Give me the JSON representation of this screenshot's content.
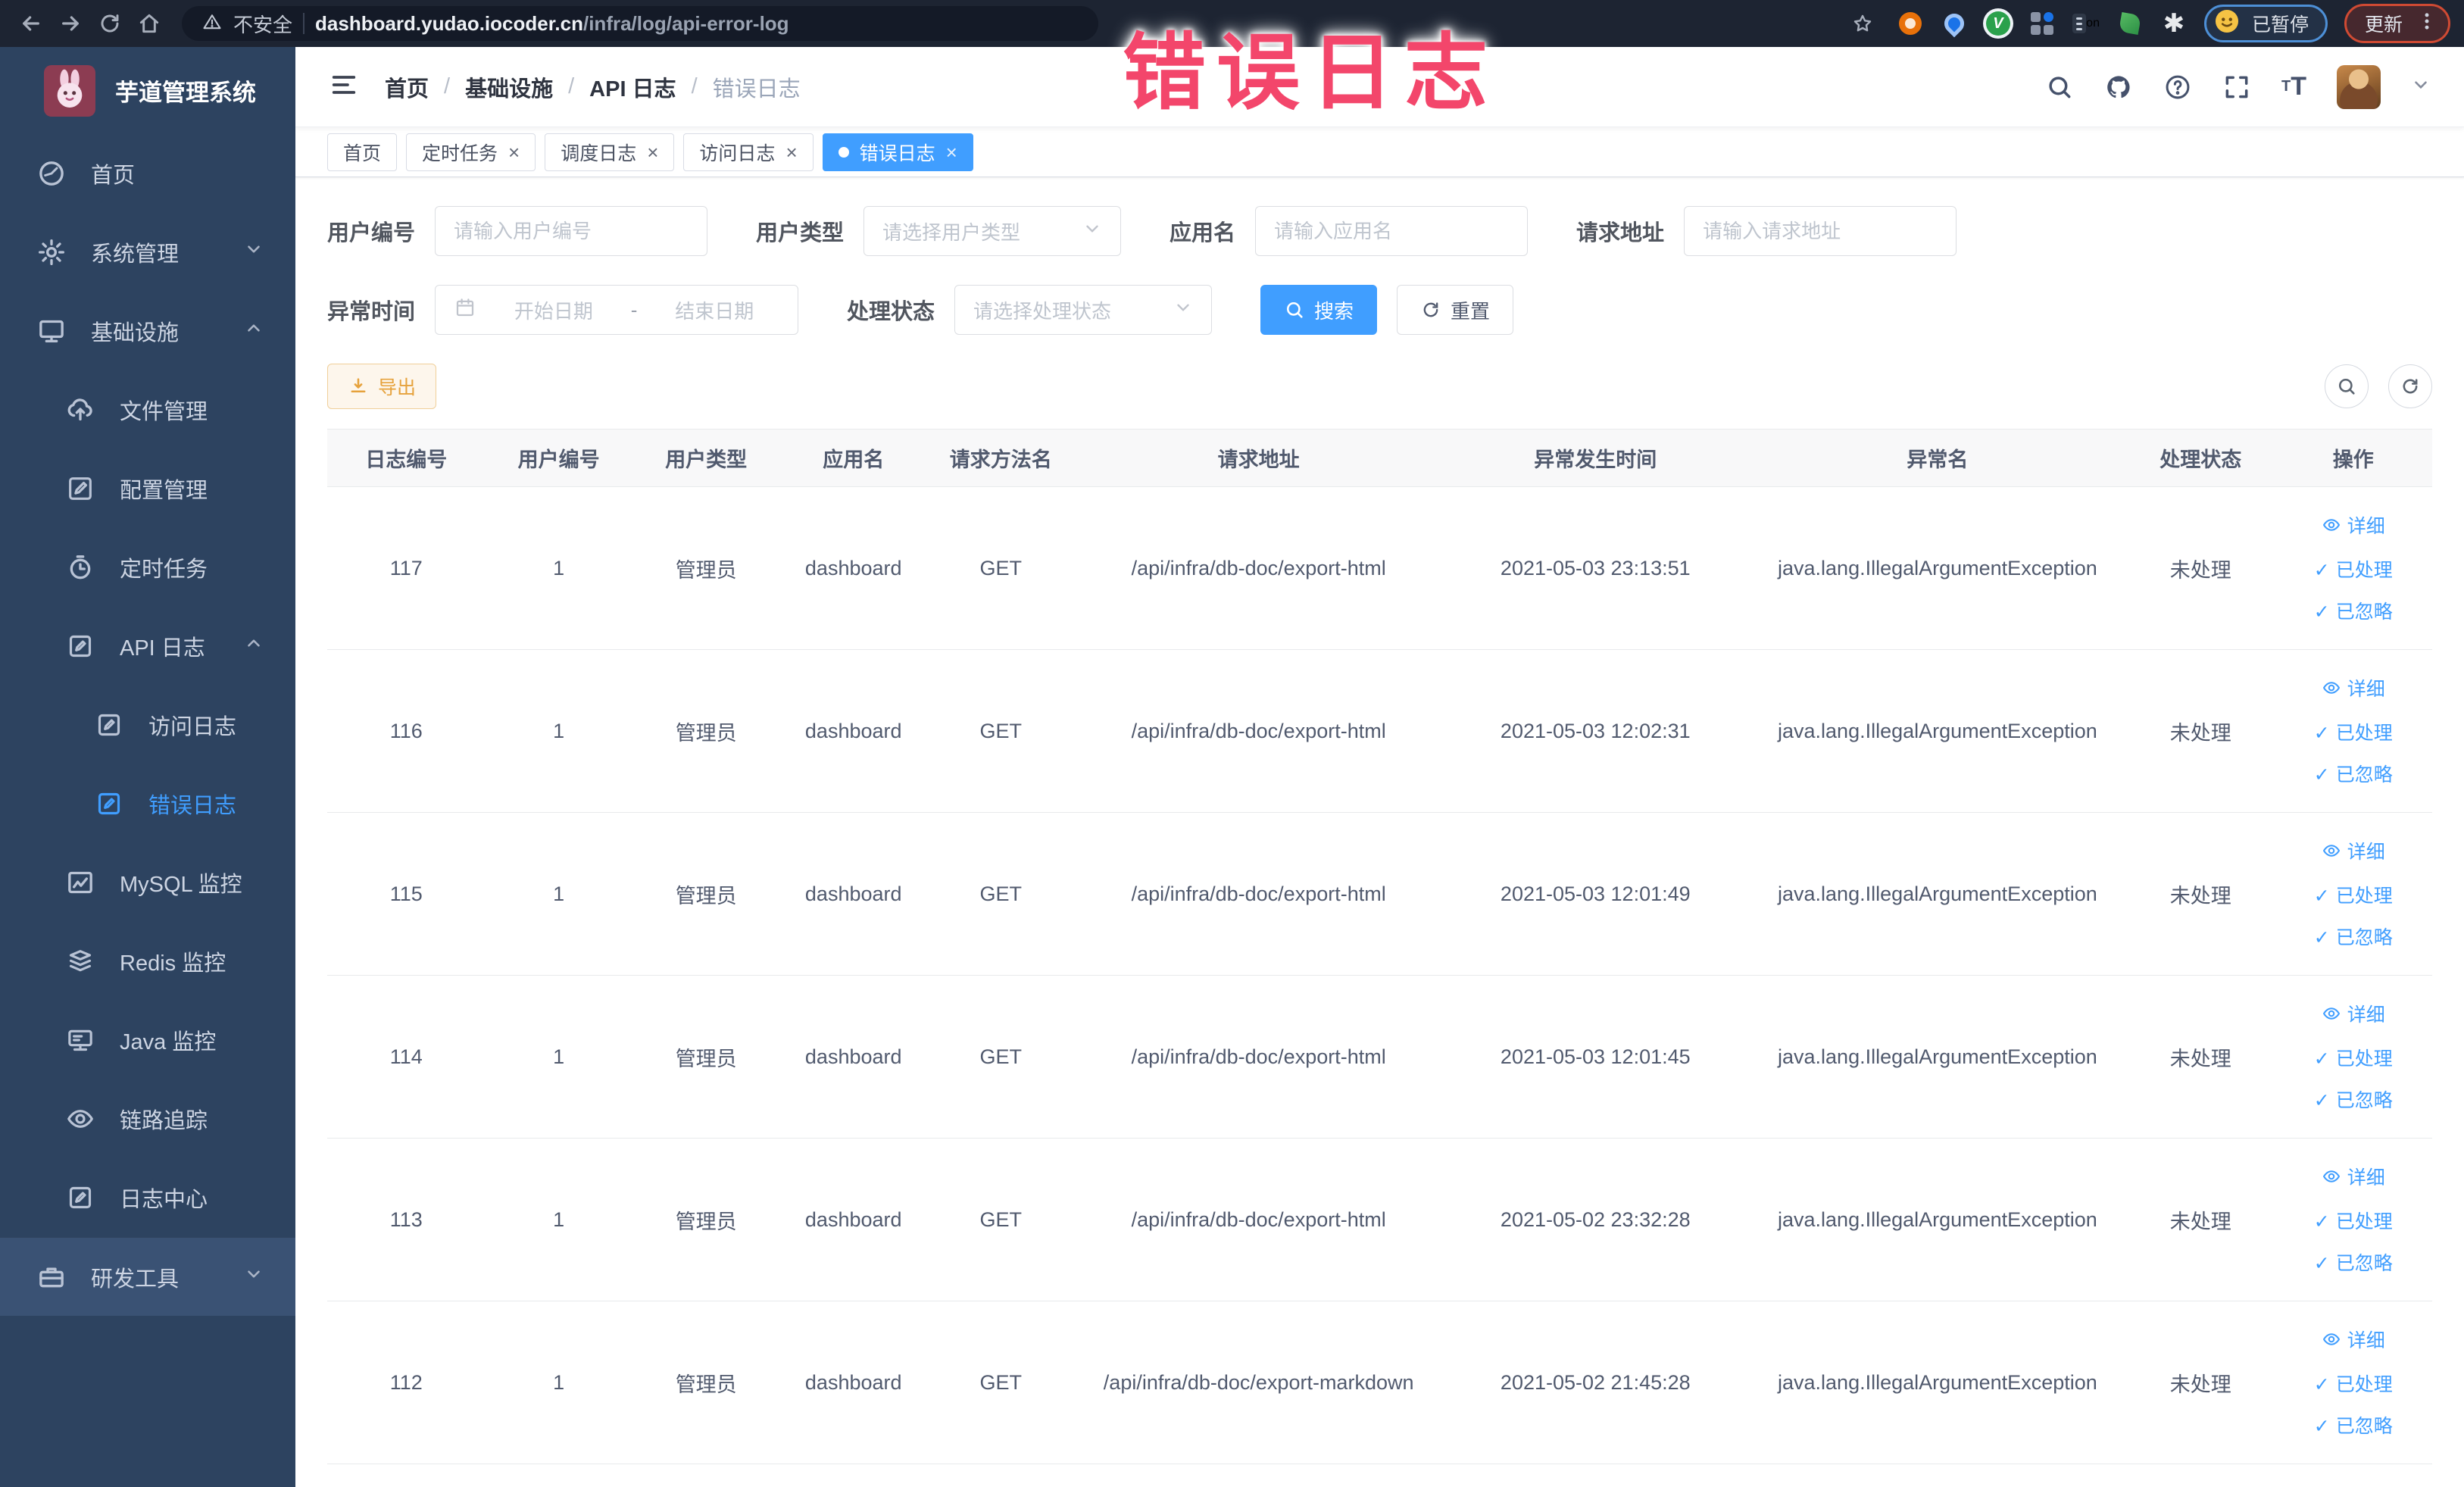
{
  "browser": {
    "security_label": "不安全",
    "url_domain": "dashboard.yudao.iocoder.cn",
    "url_path": "/infra/log/api-error-log",
    "profile_status": "已暂停",
    "update_label": "更新",
    "extension_icons": [
      "orange-ring-extension-icon",
      "blue-pin-extension-icon",
      "green-check-extension-icon",
      "grid-extension-icon",
      "on-switch-extension-icon",
      "leaf-extension-icon",
      "asterisk-extension-icon"
    ]
  },
  "annotation": {
    "text": "错误日志",
    "color": "#f3466b"
  },
  "sidebar": {
    "brand": "芋道管理系统",
    "items": [
      {
        "key": "home",
        "label": "首页",
        "icon": "dashboard-icon",
        "level": 1
      },
      {
        "key": "system",
        "label": "系统管理",
        "icon": "gear-icon",
        "level": 1,
        "chevron": "down"
      },
      {
        "key": "infra",
        "label": "基础设施",
        "icon": "monitor-icon",
        "level": 1,
        "chevron": "up"
      },
      {
        "key": "file",
        "label": "文件管理",
        "icon": "cloud-upload-icon",
        "level": 2
      },
      {
        "key": "config",
        "label": "配置管理",
        "icon": "edit-icon",
        "level": 2
      },
      {
        "key": "job",
        "label": "定时任务",
        "icon": "timer-icon",
        "level": 2
      },
      {
        "key": "api-log",
        "label": "API 日志",
        "icon": "log-icon",
        "level": 2,
        "chevron": "up"
      },
      {
        "key": "access-log",
        "label": "访问日志",
        "icon": "log-icon",
        "level": 3
      },
      {
        "key": "error-log",
        "label": "错误日志",
        "icon": "log-icon",
        "level": 3,
        "active": true
      },
      {
        "key": "mysql",
        "label": "MySQL 监控",
        "icon": "chart-icon",
        "level": 2
      },
      {
        "key": "redis",
        "label": "Redis 监控",
        "icon": "layers-icon",
        "level": 2
      },
      {
        "key": "java",
        "label": "Java 监控",
        "icon": "display-icon",
        "level": 2
      },
      {
        "key": "trace",
        "label": "链路追踪",
        "icon": "eye-icon",
        "level": 2
      },
      {
        "key": "log-center",
        "label": "日志中心",
        "icon": "log-icon",
        "level": 2
      },
      {
        "key": "dev-tool",
        "label": "研发工具",
        "icon": "toolbox-icon",
        "level": 1,
        "chevron": "down",
        "highlighted": true
      }
    ]
  },
  "navbar": {
    "breadcrumb": [
      "首页",
      "基础设施",
      "API 日志",
      "错误日志"
    ],
    "icons": [
      "search-icon",
      "github-icon",
      "help-icon",
      "fullscreen-icon",
      "font-size-icon"
    ]
  },
  "tabs": [
    {
      "key": "home",
      "label": "首页",
      "closable": false
    },
    {
      "key": "job",
      "label": "定时任务",
      "closable": true
    },
    {
      "key": "job-log",
      "label": "调度日志",
      "closable": true
    },
    {
      "key": "access-log",
      "label": "访问日志",
      "closable": true
    },
    {
      "key": "error-log",
      "label": "错误日志",
      "closable": true,
      "active": true
    }
  ],
  "filters": {
    "user_id": {
      "label": "用户编号",
      "placeholder": "请输入用户编号"
    },
    "user_type": {
      "label": "用户类型",
      "placeholder": "请选择用户类型"
    },
    "app_name": {
      "label": "应用名",
      "placeholder": "请输入应用名"
    },
    "request_url": {
      "label": "请求地址",
      "placeholder": "请输入请求地址"
    },
    "exception_time": {
      "label": "异常时间",
      "start_placeholder": "开始日期",
      "separator": "-",
      "end_placeholder": "结束日期"
    },
    "process_status": {
      "label": "处理状态",
      "placeholder": "请选择处理状态"
    },
    "search_label": "搜索",
    "reset_label": "重置"
  },
  "toolbar": {
    "export_label": "导出"
  },
  "table": {
    "columns": [
      "日志编号",
      "用户编号",
      "用户类型",
      "应用名",
      "请求方法名",
      "请求地址",
      "异常发生时间",
      "异常名",
      "处理状态",
      "操作"
    ],
    "rows": [
      {
        "log_id": "117",
        "user_id": "1",
        "user_type": "管理员",
        "app_name": "dashboard",
        "method": "GET",
        "request_url": "/api/infra/db-doc/export-html",
        "exception_time": "2021-05-03 23:13:51",
        "exception_name": "java.lang.IllegalArgumentException",
        "process_status": "未处理"
      },
      {
        "log_id": "116",
        "user_id": "1",
        "user_type": "管理员",
        "app_name": "dashboard",
        "method": "GET",
        "request_url": "/api/infra/db-doc/export-html",
        "exception_time": "2021-05-03 12:02:31",
        "exception_name": "java.lang.IllegalArgumentException",
        "process_status": "未处理"
      },
      {
        "log_id": "115",
        "user_id": "1",
        "user_type": "管理员",
        "app_name": "dashboard",
        "method": "GET",
        "request_url": "/api/infra/db-doc/export-html",
        "exception_time": "2021-05-03 12:01:49",
        "exception_name": "java.lang.IllegalArgumentException",
        "process_status": "未处理"
      },
      {
        "log_id": "114",
        "user_id": "1",
        "user_type": "管理员",
        "app_name": "dashboard",
        "method": "GET",
        "request_url": "/api/infra/db-doc/export-html",
        "exception_time": "2021-05-03 12:01:45",
        "exception_name": "java.lang.IllegalArgumentException",
        "process_status": "未处理"
      },
      {
        "log_id": "113",
        "user_id": "1",
        "user_type": "管理员",
        "app_name": "dashboard",
        "method": "GET",
        "request_url": "/api/infra/db-doc/export-html",
        "exception_time": "2021-05-02 23:32:28",
        "exception_name": "java.lang.IllegalArgumentException",
        "process_status": "未处理"
      },
      {
        "log_id": "112",
        "user_id": "1",
        "user_type": "管理员",
        "app_name": "dashboard",
        "method": "GET",
        "request_url": "/api/infra/db-doc/export-markdown",
        "exception_time": "2021-05-02 21:45:28",
        "exception_name": "java.lang.IllegalArgumentException",
        "process_status": "未处理"
      }
    ],
    "row_actions": [
      {
        "label": "详细",
        "icon": "eye-icon"
      },
      {
        "label": "已处理",
        "icon": "check-icon"
      },
      {
        "label": "已忽略",
        "icon": "check-icon"
      }
    ]
  },
  "colors": {
    "accent": "#409eff",
    "export_text": "#e6a23c",
    "sidebar_bg": "#2d4360",
    "annotation": "#f3466b"
  }
}
